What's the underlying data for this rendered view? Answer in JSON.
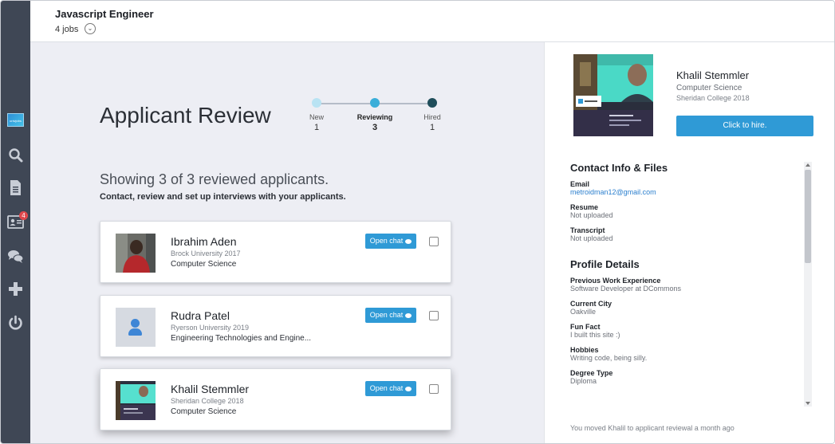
{
  "header": {
    "job_title": "Javascript Engineer",
    "jobs_count": "4 jobs"
  },
  "sidebar": {
    "logo_text": "univjobs",
    "items": [
      {
        "icon": "search-icon"
      },
      {
        "icon": "document-icon"
      },
      {
        "icon": "applicants-card-icon",
        "badge": "4"
      },
      {
        "icon": "chat-icon"
      },
      {
        "icon": "plus-icon"
      },
      {
        "icon": "power-icon"
      }
    ]
  },
  "main": {
    "title": "Applicant Review",
    "stepper": [
      {
        "label": "New",
        "count": "1",
        "color": "#b9e3f3"
      },
      {
        "label": "Reviewing",
        "count": "3",
        "color": "#3aaed9"
      },
      {
        "label": "Hired",
        "count": "1",
        "color": "#1f4d5a"
      }
    ],
    "showing": "Showing 3 of 3 reviewed applicants.",
    "subtitle": "Contact, review and set up interviews with your applicants.",
    "chat_label": "Open chat",
    "applicants": [
      {
        "name": "Ibrahim Aden",
        "school": "Brock University 2017",
        "program": "Computer Science"
      },
      {
        "name": "Rudra Patel",
        "school": "Ryerson University 2019",
        "program": "Engineering Technologies and Engine..."
      },
      {
        "name": "Khalil Stemmler",
        "school": "Sheridan College 2018",
        "program": "Computer Science"
      }
    ]
  },
  "profile": {
    "name": "Khalil Stemmler",
    "program": "Computer Science",
    "school": "Sheridan College 2018",
    "hire_label": "Click to hire.",
    "contact_title": "Contact Info & Files",
    "contact": [
      {
        "label": "Email",
        "value": "metroidman12@gmail.com"
      },
      {
        "label": "Resume",
        "value": "Not uploaded"
      },
      {
        "label": "Transcript",
        "value": "Not uploaded"
      }
    ],
    "details_title": "Profile Details",
    "details": [
      {
        "label": "Previous Work Experience",
        "value": "Software Developer at DCommons"
      },
      {
        "label": "Current City",
        "value": "Oakville"
      },
      {
        "label": "Fun Fact",
        "value": "I built this site :)"
      },
      {
        "label": "Hobbies",
        "value": "Writing code, being silly."
      },
      {
        "label": "Degree Type",
        "value": "Diploma"
      }
    ],
    "activity": "You moved Khalil to applicant reviewal a month ago"
  },
  "colors": {
    "accent": "#2f9ad6",
    "sidebar": "#3f4755",
    "main_bg": "#edeef4",
    "badge": "#e0474c"
  }
}
